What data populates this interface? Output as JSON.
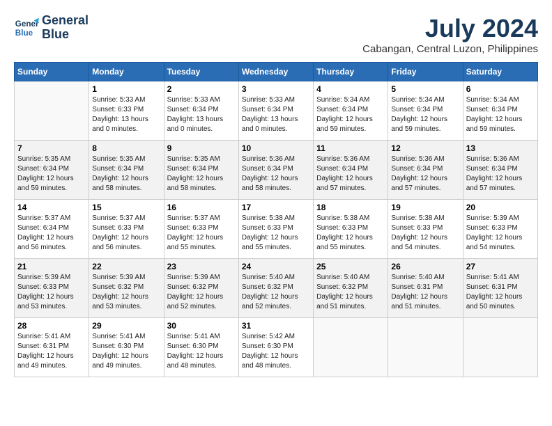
{
  "header": {
    "logo_line1": "General",
    "logo_line2": "Blue",
    "month_year": "July 2024",
    "location": "Cabangan, Central Luzon, Philippines"
  },
  "weekdays": [
    "Sunday",
    "Monday",
    "Tuesday",
    "Wednesday",
    "Thursday",
    "Friday",
    "Saturday"
  ],
  "weeks": [
    [
      {
        "day": "",
        "sunrise": "",
        "sunset": "",
        "daylight": ""
      },
      {
        "day": "1",
        "sunrise": "Sunrise: 5:33 AM",
        "sunset": "Sunset: 6:33 PM",
        "daylight": "Daylight: 13 hours and 0 minutes."
      },
      {
        "day": "2",
        "sunrise": "Sunrise: 5:33 AM",
        "sunset": "Sunset: 6:34 PM",
        "daylight": "Daylight: 13 hours and 0 minutes."
      },
      {
        "day": "3",
        "sunrise": "Sunrise: 5:33 AM",
        "sunset": "Sunset: 6:34 PM",
        "daylight": "Daylight: 13 hours and 0 minutes."
      },
      {
        "day": "4",
        "sunrise": "Sunrise: 5:34 AM",
        "sunset": "Sunset: 6:34 PM",
        "daylight": "Daylight: 12 hours and 59 minutes."
      },
      {
        "day": "5",
        "sunrise": "Sunrise: 5:34 AM",
        "sunset": "Sunset: 6:34 PM",
        "daylight": "Daylight: 12 hours and 59 minutes."
      },
      {
        "day": "6",
        "sunrise": "Sunrise: 5:34 AM",
        "sunset": "Sunset: 6:34 PM",
        "daylight": "Daylight: 12 hours and 59 minutes."
      }
    ],
    [
      {
        "day": "7",
        "sunrise": "Sunrise: 5:35 AM",
        "sunset": "Sunset: 6:34 PM",
        "daylight": "Daylight: 12 hours and 59 minutes."
      },
      {
        "day": "8",
        "sunrise": "Sunrise: 5:35 AM",
        "sunset": "Sunset: 6:34 PM",
        "daylight": "Daylight: 12 hours and 58 minutes."
      },
      {
        "day": "9",
        "sunrise": "Sunrise: 5:35 AM",
        "sunset": "Sunset: 6:34 PM",
        "daylight": "Daylight: 12 hours and 58 minutes."
      },
      {
        "day": "10",
        "sunrise": "Sunrise: 5:36 AM",
        "sunset": "Sunset: 6:34 PM",
        "daylight": "Daylight: 12 hours and 58 minutes."
      },
      {
        "day": "11",
        "sunrise": "Sunrise: 5:36 AM",
        "sunset": "Sunset: 6:34 PM",
        "daylight": "Daylight: 12 hours and 57 minutes."
      },
      {
        "day": "12",
        "sunrise": "Sunrise: 5:36 AM",
        "sunset": "Sunset: 6:34 PM",
        "daylight": "Daylight: 12 hours and 57 minutes."
      },
      {
        "day": "13",
        "sunrise": "Sunrise: 5:36 AM",
        "sunset": "Sunset: 6:34 PM",
        "daylight": "Daylight: 12 hours and 57 minutes."
      }
    ],
    [
      {
        "day": "14",
        "sunrise": "Sunrise: 5:37 AM",
        "sunset": "Sunset: 6:34 PM",
        "daylight": "Daylight: 12 hours and 56 minutes."
      },
      {
        "day": "15",
        "sunrise": "Sunrise: 5:37 AM",
        "sunset": "Sunset: 6:33 PM",
        "daylight": "Daylight: 12 hours and 56 minutes."
      },
      {
        "day": "16",
        "sunrise": "Sunrise: 5:37 AM",
        "sunset": "Sunset: 6:33 PM",
        "daylight": "Daylight: 12 hours and 55 minutes."
      },
      {
        "day": "17",
        "sunrise": "Sunrise: 5:38 AM",
        "sunset": "Sunset: 6:33 PM",
        "daylight": "Daylight: 12 hours and 55 minutes."
      },
      {
        "day": "18",
        "sunrise": "Sunrise: 5:38 AM",
        "sunset": "Sunset: 6:33 PM",
        "daylight": "Daylight: 12 hours and 55 minutes."
      },
      {
        "day": "19",
        "sunrise": "Sunrise: 5:38 AM",
        "sunset": "Sunset: 6:33 PM",
        "daylight": "Daylight: 12 hours and 54 minutes."
      },
      {
        "day": "20",
        "sunrise": "Sunrise: 5:39 AM",
        "sunset": "Sunset: 6:33 PM",
        "daylight": "Daylight: 12 hours and 54 minutes."
      }
    ],
    [
      {
        "day": "21",
        "sunrise": "Sunrise: 5:39 AM",
        "sunset": "Sunset: 6:33 PM",
        "daylight": "Daylight: 12 hours and 53 minutes."
      },
      {
        "day": "22",
        "sunrise": "Sunrise: 5:39 AM",
        "sunset": "Sunset: 6:32 PM",
        "daylight": "Daylight: 12 hours and 53 minutes."
      },
      {
        "day": "23",
        "sunrise": "Sunrise: 5:39 AM",
        "sunset": "Sunset: 6:32 PM",
        "daylight": "Daylight: 12 hours and 52 minutes."
      },
      {
        "day": "24",
        "sunrise": "Sunrise: 5:40 AM",
        "sunset": "Sunset: 6:32 PM",
        "daylight": "Daylight: 12 hours and 52 minutes."
      },
      {
        "day": "25",
        "sunrise": "Sunrise: 5:40 AM",
        "sunset": "Sunset: 6:32 PM",
        "daylight": "Daylight: 12 hours and 51 minutes."
      },
      {
        "day": "26",
        "sunrise": "Sunrise: 5:40 AM",
        "sunset": "Sunset: 6:31 PM",
        "daylight": "Daylight: 12 hours and 51 minutes."
      },
      {
        "day": "27",
        "sunrise": "Sunrise: 5:41 AM",
        "sunset": "Sunset: 6:31 PM",
        "daylight": "Daylight: 12 hours and 50 minutes."
      }
    ],
    [
      {
        "day": "28",
        "sunrise": "Sunrise: 5:41 AM",
        "sunset": "Sunset: 6:31 PM",
        "daylight": "Daylight: 12 hours and 49 minutes."
      },
      {
        "day": "29",
        "sunrise": "Sunrise: 5:41 AM",
        "sunset": "Sunset: 6:30 PM",
        "daylight": "Daylight: 12 hours and 49 minutes."
      },
      {
        "day": "30",
        "sunrise": "Sunrise: 5:41 AM",
        "sunset": "Sunset: 6:30 PM",
        "daylight": "Daylight: 12 hours and 48 minutes."
      },
      {
        "day": "31",
        "sunrise": "Sunrise: 5:42 AM",
        "sunset": "Sunset: 6:30 PM",
        "daylight": "Daylight: 12 hours and 48 minutes."
      },
      {
        "day": "",
        "sunrise": "",
        "sunset": "",
        "daylight": ""
      },
      {
        "day": "",
        "sunrise": "",
        "sunset": "",
        "daylight": ""
      },
      {
        "day": "",
        "sunrise": "",
        "sunset": "",
        "daylight": ""
      }
    ]
  ]
}
